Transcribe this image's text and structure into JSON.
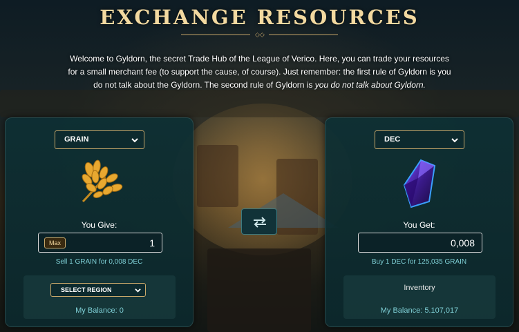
{
  "header": {
    "title": "EXCHANGE RESOURCES",
    "intro_line1": "Welcome to Gyldorn, the secret Trade Hub of the League of Verico. Here, you can trade your resources",
    "intro_line2": "for a small merchant fee (to support the cause, of course). Just remember: the first rule of Gyldorn is you",
    "intro_line3_plain": "do not talk about the Gyldorn. The second rule of Gyldorn is ",
    "intro_line3_italic": "you do not talk about Gyldorn."
  },
  "give_panel": {
    "resource_selected": "GRAIN",
    "resource_icon": "grain-icon",
    "label": "You Give:",
    "max_label": "Max",
    "amount": "1",
    "rate_text": "Sell 1 GRAIN for 0,008 DEC",
    "region_select": "SELECT REGION",
    "balance_text": "My Balance: 0"
  },
  "get_panel": {
    "resource_selected": "DEC",
    "resource_icon": "dec-crystal-icon",
    "label": "You Get:",
    "amount": "0,008",
    "rate_text": "Buy 1 DEC for 125,035 GRAIN",
    "inventory_title": "Inventory",
    "balance_text": "My Balance: 5.107,017"
  },
  "swap": {
    "icon": "swap-arrows-icon"
  },
  "colors": {
    "title": "#f3d9a0",
    "accent_gold": "#c9a86a",
    "panel_bg": "#0e3034",
    "rate_text": "#7fd0d6"
  }
}
